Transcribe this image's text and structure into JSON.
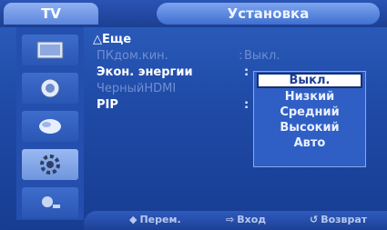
{
  "top": {
    "tab_label": "TV",
    "title": "Установка"
  },
  "sidebar": {
    "icons": [
      "picture-icon",
      "sound-icon",
      "channel-icon",
      "setup-icon",
      "input-icon"
    ]
  },
  "menu": {
    "more_label": "Еще",
    "more_arrow": "△",
    "pc_home_label": "ПКдом.кин.",
    "pc_home_value": "Выкл.",
    "energy_label": "Экон. энергии",
    "black_hdmi_label": "ЧерныйHDMI",
    "pip_label": "PIP",
    "colon": ":"
  },
  "dropdown": {
    "options": [
      "Выкл.",
      "Низкий",
      "Средний",
      "Высокий",
      "Авто"
    ],
    "selected": "Выкл."
  },
  "footer": {
    "move_label": "Перем.",
    "enter_label": "Вход",
    "return_label": "Возврат",
    "move_icon": "◆",
    "enter_icon": "⇨",
    "return_icon": "↺"
  },
  "colors": {
    "background": "#1f4aa6",
    "highlight": "#ffffff",
    "dim_text": "#6f8fd0"
  }
}
